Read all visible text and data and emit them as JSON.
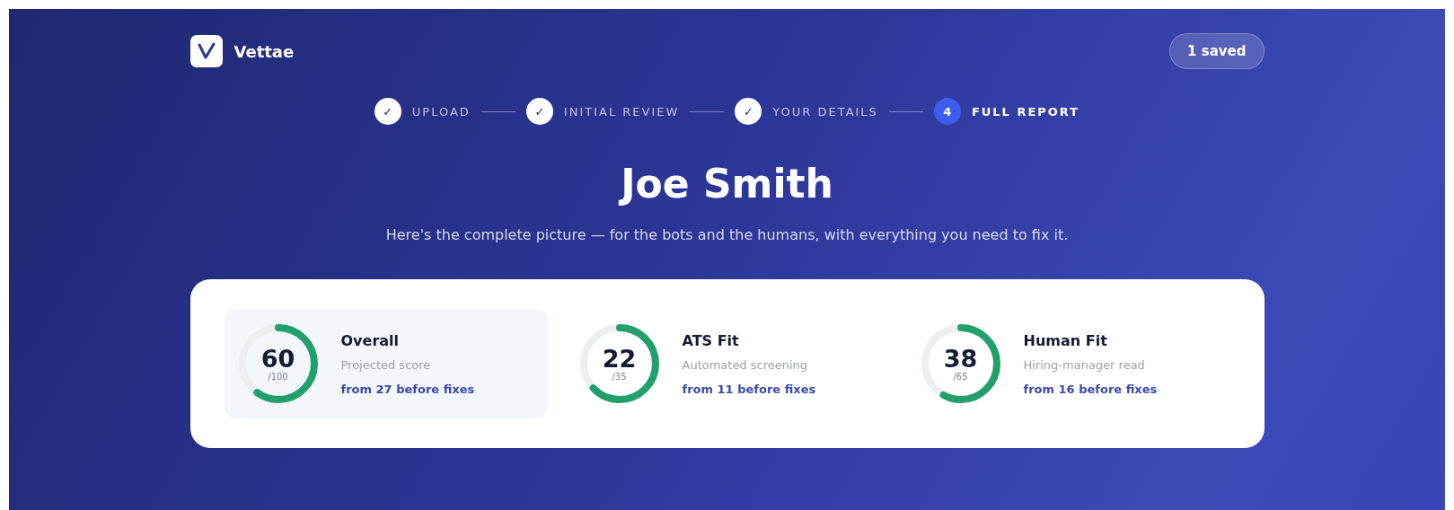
{
  "brand": {
    "name": "Vettae"
  },
  "saved_badge": "1 saved",
  "steps": [
    {
      "marker": "✓",
      "label": "UPLOAD",
      "current": false
    },
    {
      "marker": "✓",
      "label": "INITIAL REVIEW",
      "current": false
    },
    {
      "marker": "✓",
      "label": "YOUR DETAILS",
      "current": false
    },
    {
      "marker": "4",
      "label": "FULL REPORT",
      "current": true
    }
  ],
  "title": "Joe Smith",
  "subtitle": "Here's the complete picture — for the bots and the humans, with everything you need to fix it.",
  "scores": [
    {
      "value": "60",
      "max": "/100",
      "level": 0.6,
      "name": "Overall",
      "description": "Projected score",
      "before": "from 27 before fixes",
      "selected": true
    },
    {
      "value": "22",
      "max": "/35",
      "level": 0.63,
      "name": "ATS Fit",
      "description": "Automated screening",
      "before": "from 11 before fixes",
      "selected": false
    },
    {
      "value": "38",
      "max": "/65",
      "level": 0.58,
      "name": "Human Fit",
      "description": "Hiring-manager read",
      "before": "from 16 before fixes",
      "selected": false
    }
  ]
}
